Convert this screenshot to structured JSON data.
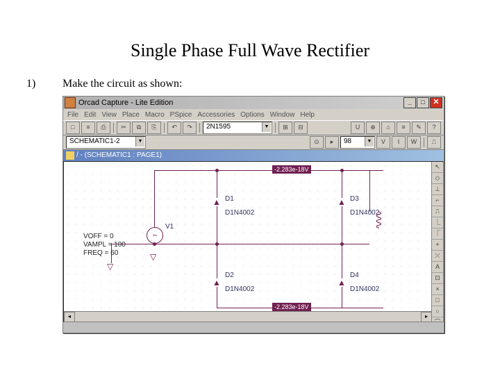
{
  "page": {
    "title": "Single Phase Full Wave Rectifier",
    "step_number": "1)",
    "step_text": "Make the circuit as shown:"
  },
  "window": {
    "title": "Orcad Capture - Lite Edition",
    "titlebar_buttons": {
      "min": "_",
      "max": "□",
      "close": "✕"
    },
    "menu": [
      "File",
      "Edit",
      "View",
      "Place",
      "Macro",
      "PSpice",
      "Accessories",
      "Options",
      "Window",
      "Help"
    ],
    "toolbar1": {
      "part_combo": "2N1595",
      "buttons": [
        "□",
        "≡",
        "⎙",
        "",
        "✂",
        "⧉",
        "⎘",
        "",
        "↶",
        "↷"
      ]
    },
    "toolbar2": {
      "sheet_combo": "SCHEMATIC1-2",
      "zoom_combo": "98",
      "buttons": [
        "⊕",
        "⊖",
        "",
        "V",
        "I",
        "W"
      ]
    },
    "doc_title": "/ - (SCHEMATIC1 : PAGE1)",
    "side_tools": [
      "↖",
      "◇",
      "⊥",
      "⌐",
      "⎍",
      "⎿",
      "⎾",
      "+",
      "⤫",
      "A",
      "⊡",
      "×",
      "□",
      "○",
      "⌒",
      "⎯"
    ]
  },
  "schematic": {
    "net_voltage": "-2.283e-18V",
    "source": {
      "refdes": "V1",
      "voff": "VOFF = 0",
      "vampl": "VAMPL = 100",
      "freq": "FREQ = 60"
    },
    "diodes": {
      "d1": {
        "ref": "D1",
        "value": "D1N4002"
      },
      "d2": {
        "ref": "D2",
        "value": "D1N4002"
      },
      "d3": {
        "ref": "D3",
        "value": "D1N4002"
      },
      "d4": {
        "ref": "D4",
        "value": "D1N4002"
      }
    }
  }
}
